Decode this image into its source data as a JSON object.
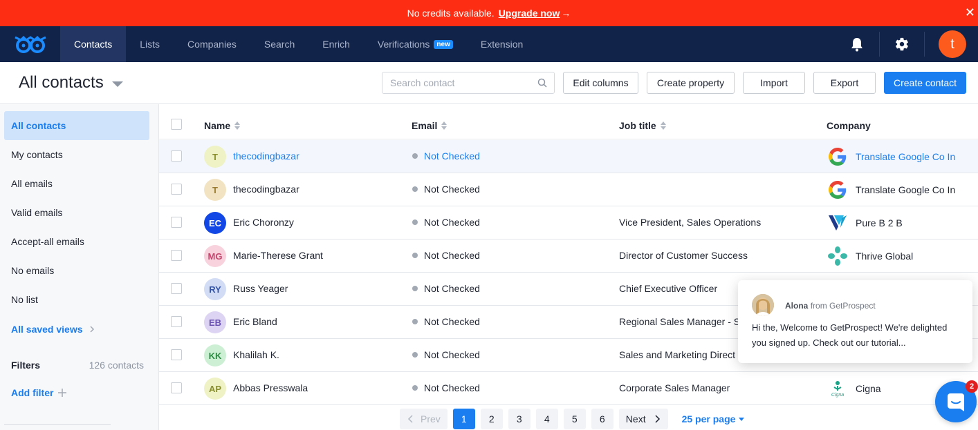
{
  "banner": {
    "text": "No credits available.",
    "link": "Upgrade now",
    "arrow": "→",
    "close": "✕",
    "color": "#fc2d12"
  },
  "nav": {
    "logo": "owl-logo",
    "tabs": [
      "Contacts",
      "Lists",
      "Companies",
      "Search",
      "Enrich",
      "Verifications",
      "Extension"
    ],
    "active_tab": "Contacts",
    "new_badge": "new",
    "avatar_letter": "t",
    "bg_color": "#12234a"
  },
  "header": {
    "title": "All contacts",
    "search_placeholder": "Search contact",
    "buttons": {
      "edit_columns": "Edit columns",
      "create_property": "Create property",
      "import": "Import",
      "export": "Export",
      "create_contact": "Create contact"
    }
  },
  "sidebar": {
    "items": [
      "All contacts",
      "My contacts",
      "All emails",
      "Valid emails",
      "Accept-all emails",
      "No emails",
      "No list"
    ],
    "active_item": "All contacts",
    "saved_views": "All saved views",
    "filters_label": "Filters",
    "filters_count": "126 contacts",
    "add_filter": "Add filter"
  },
  "table": {
    "columns": [
      "Name",
      "Email",
      "Job title",
      "Company"
    ],
    "rows": [
      {
        "initials": "T",
        "name": "thecodingbazar",
        "email": "Not Checked",
        "job": "",
        "company": "Translate Google Co In",
        "logo": "google-icon",
        "av_bg": "#eef2c4",
        "av_fg": "#8a8f2e"
      },
      {
        "initials": "T",
        "name": "thecodingbazar",
        "email": "Not Checked",
        "job": "",
        "company": "Translate Google Co In",
        "logo": "google-icon",
        "av_bg": "#f2e4c2",
        "av_fg": "#9a7a30"
      },
      {
        "initials": "EC",
        "name": "Eric Choronzy",
        "email": "Not Checked",
        "job": "Vice President, Sales Operations",
        "company": "Pure B 2 B",
        "logo": "pureb2b-icon",
        "av_bg": "#1247e6",
        "av_fg": "#ffffff"
      },
      {
        "initials": "MG",
        "name": "Marie-Therese Grant",
        "email": "Not Checked",
        "job": "Director of Customer Success",
        "company": "Thrive Global",
        "logo": "thrive-icon",
        "av_bg": "#f8d3de",
        "av_fg": "#c4456e"
      },
      {
        "initials": "RY",
        "name": "Russ Yeager",
        "email": "Not Checked",
        "job": "Chief Executive Officer",
        "company": "",
        "logo": "",
        "av_bg": "#d2dcf5",
        "av_fg": "#3454a8"
      },
      {
        "initials": "EB",
        "name": "Eric Bland",
        "email": "Not Checked",
        "job": "Regional Sales Manager - S",
        "company": "",
        "logo": "",
        "av_bg": "#dcd4f2",
        "av_fg": "#6a52b2"
      },
      {
        "initials": "KK",
        "name": "Khalilah K.",
        "email": "Not Checked",
        "job": "Sales and Marketing Direct",
        "company": "",
        "logo": "",
        "av_bg": "#cdf0d5",
        "av_fg": "#2e8c44"
      },
      {
        "initials": "AP",
        "name": "Abbas Presswala",
        "email": "Not Checked",
        "job": "Corporate Sales Manager",
        "company": "Cigna",
        "logo": "cigna-icon",
        "av_bg": "#eef2c4",
        "av_fg": "#8a8f2e"
      }
    ]
  },
  "pagination": {
    "prev": "Prev",
    "pages": [
      "1",
      "2",
      "3",
      "4",
      "5",
      "6"
    ],
    "active_page": "1",
    "next": "Next",
    "per_page": "25 per page"
  },
  "chat": {
    "agent": "Alona",
    "from": "from GetProspect",
    "message": "Hi the,  Welcome to GetProspect! We're delighted you signed up. Check out our tutorial...",
    "badge": "2"
  },
  "colors": {
    "accent": "#1a7ef0",
    "active_sidebar_bg": "#cfe3fb"
  }
}
